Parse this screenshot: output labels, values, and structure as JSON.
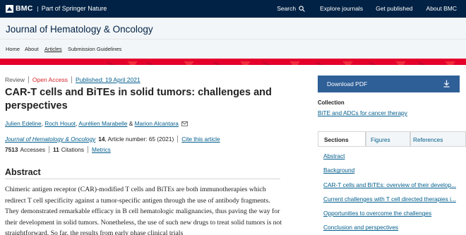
{
  "brand": {
    "logo_text": "BMC",
    "tagline": "Part of Springer Nature"
  },
  "topnav": {
    "search": "Search",
    "explore": "Explore journals",
    "publish": "Get published",
    "about": "About BMC"
  },
  "journal": {
    "title": "Journal of Hematology & Oncology"
  },
  "subnav": {
    "home": "Home",
    "about": "About",
    "articles": "Articles",
    "guidelines": "Submission Guidelines"
  },
  "article": {
    "type": "Review",
    "access": "Open Access",
    "published": "Published: 19 April 2021",
    "title": "CAR-T cells and BiTEs in solid tumors: challenges and perspectives",
    "authors": [
      "Julien Edeline",
      "Roch Houot",
      "Aurélien Marabelle",
      "Marion Alcantara"
    ],
    "author_separators": {
      "comma": ", ",
      "amp": " & "
    },
    "journal_name": "Journal of Hematology & Oncology",
    "volume": "14",
    "article_number": ", Article number: 65 (2021)",
    "cite_link": "Cite this article",
    "accesses_count": "7513",
    "accesses_label": "Accesses",
    "citations_count": "11",
    "citations_label": "Citations",
    "metrics_link": "Metrics"
  },
  "abstract": {
    "heading": "Abstract",
    "text": "Chimeric antigen receptor (CAR)-modified T cells and BiTEs are both immunotherapies which redirect T cell specificity against a tumor-specific antigen through the use of antibody fragments. They demonstrated remarkable efficacy in B cell hematologic malignancies, thus paving the way for their development in solid tumors. Nonetheless, the use of such new drugs to treat solid tumors is not straightforward. So far, the results from early phase clinical trials"
  },
  "sidebar": {
    "download_label": "Download PDF",
    "collection_heading": "Collection",
    "collection_link": "BiTE and ADCs for cancer therapy",
    "tabs": [
      "Sections",
      "Figures",
      "References"
    ],
    "sections": [
      "Abstract",
      "Background",
      "CAR-T cells and BiTEs: overview of their develop...",
      "Current challenges with T cell directed therapies i...",
      "Opportunities to overcome the challenges",
      "Conclusion and perspectives"
    ]
  },
  "colors": {
    "topbar": "#012245",
    "accent_red": "#e4002b",
    "link": "#025e8d",
    "button": "#2e5f97",
    "open_access": "#d5242a"
  }
}
